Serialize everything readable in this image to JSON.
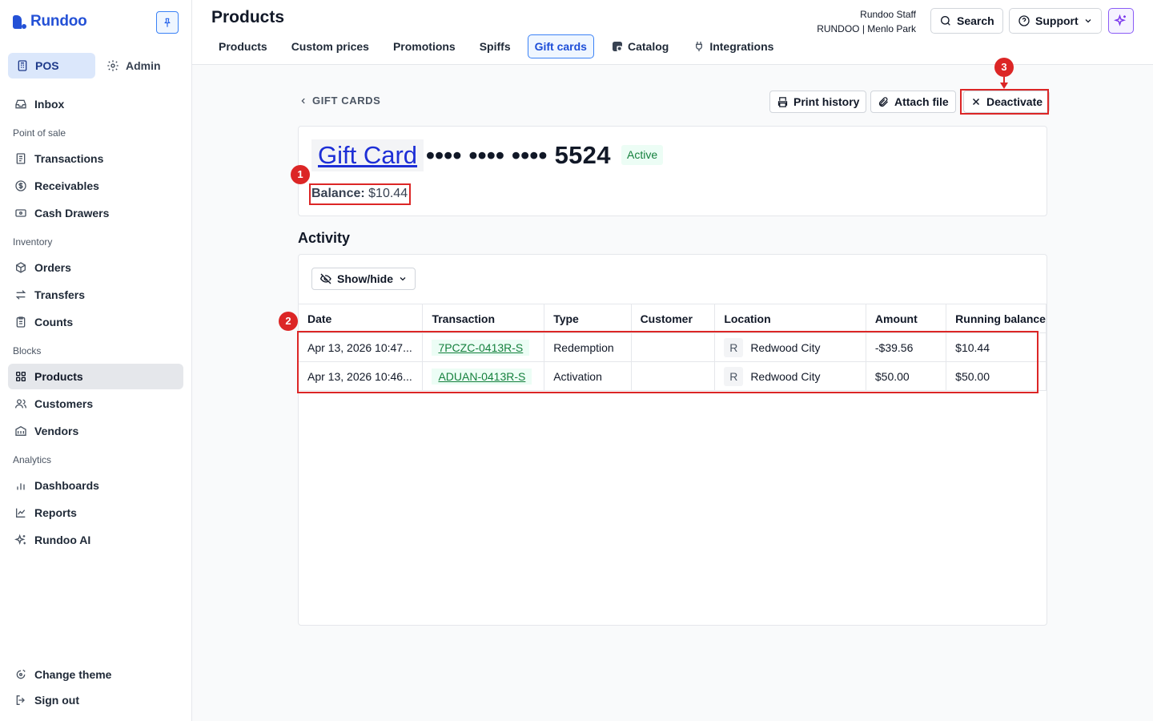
{
  "brand": {
    "name": "Rundoo"
  },
  "sidebar": {
    "modes": [
      {
        "label": "POS"
      },
      {
        "label": "Admin"
      }
    ],
    "inbox": "Inbox",
    "sections": {
      "point_of_sale": "Point of sale",
      "inventory": "Inventory",
      "blocks": "Blocks",
      "analytics": "Analytics"
    },
    "items": {
      "transactions": "Transactions",
      "receivables": "Receivables",
      "cash_drawers": "Cash Drawers",
      "orders": "Orders",
      "transfers": "Transfers",
      "counts": "Counts",
      "products": "Products",
      "customers": "Customers",
      "vendors": "Vendors",
      "dashboards": "Dashboards",
      "reports": "Reports",
      "rundoo_ai": "Rundoo AI"
    },
    "footer": {
      "change_theme": "Change theme",
      "sign_out": "Sign out"
    }
  },
  "header": {
    "title": "Products",
    "tabs": [
      {
        "label": "Products"
      },
      {
        "label": "Custom prices"
      },
      {
        "label": "Promotions"
      },
      {
        "label": "Spiffs"
      },
      {
        "label": "Gift cards",
        "active": true
      },
      {
        "label": "Catalog"
      },
      {
        "label": "Integrations"
      }
    ],
    "user": {
      "name": "Rundoo Staff",
      "org": "RUNDOO | Menlo Park"
    },
    "search_label": "Search",
    "support_label": "Support"
  },
  "page": {
    "back_label": "GIFT CARDS",
    "actions": {
      "print": "Print history",
      "attach": "Attach file",
      "deactivate": "Deactivate"
    },
    "card": {
      "title_link": "Gift Card",
      "masked_number": "•••• •••• •••• 5524",
      "status": "Active",
      "balance_label": "Balance:",
      "balance_value": "$10.44"
    },
    "activity": {
      "title": "Activity",
      "show_hide": "Show/hide",
      "columns": [
        "Date",
        "Transaction",
        "Type",
        "Customer",
        "Location",
        "Amount",
        "Running balance"
      ],
      "rows": [
        {
          "date": "Apr 13, 2026 10:47...",
          "transaction": "7PCZC-0413R-S",
          "type": "Redemption",
          "customer": "",
          "location_badge": "R",
          "location": "Redwood City",
          "amount": "-$39.56",
          "running": "$10.44"
        },
        {
          "date": "Apr 13, 2026 10:46...",
          "transaction": "ADUAN-0413R-S",
          "type": "Activation",
          "customer": "",
          "location_badge": "R",
          "location": "Redwood City",
          "amount": "$50.00",
          "running": "$50.00"
        }
      ]
    }
  },
  "annotations": [
    "1",
    "2",
    "3"
  ],
  "colors": {
    "accent": "#2451d6",
    "annotation": "#dc2626",
    "active_green": "#15803d"
  }
}
